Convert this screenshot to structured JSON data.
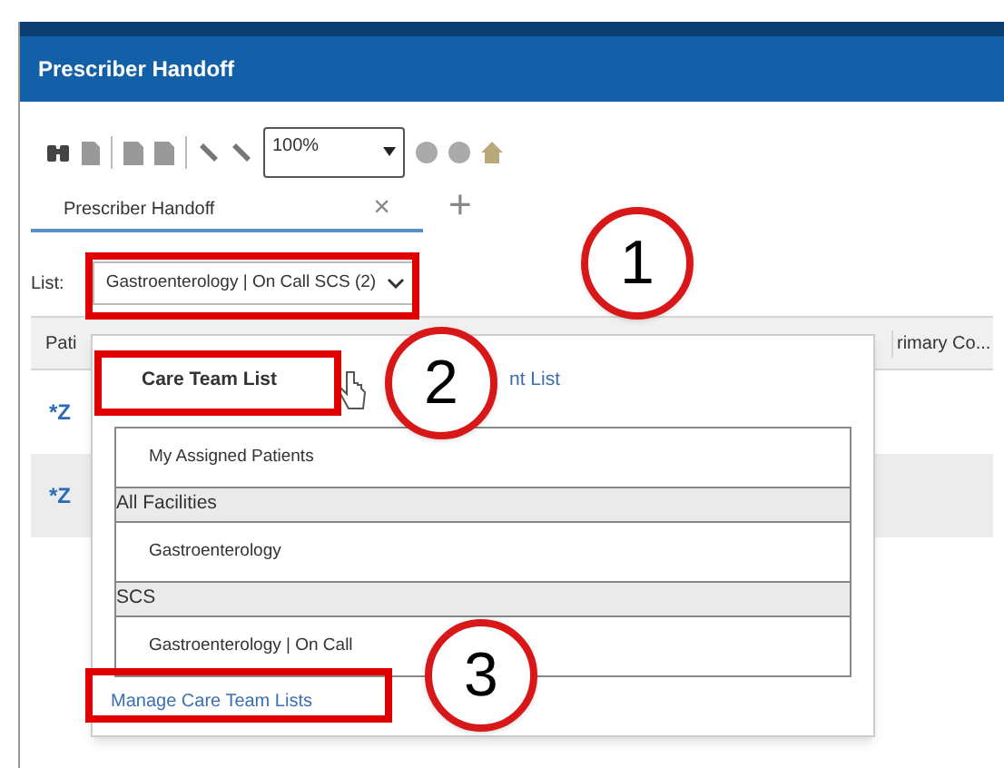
{
  "window": {
    "title": "Prescriber Handoff"
  },
  "toolbar": {
    "zoom": "100%"
  },
  "tabs": [
    {
      "label": "Prescriber Handoff",
      "selected": true,
      "close": "×"
    }
  ],
  "new_tab": "+",
  "list_selector": {
    "label": "List:",
    "value": "Gastroenterology | On Call SCS (2)"
  },
  "table": {
    "columns": [
      "Pati",
      "rimary Co..."
    ],
    "rows": [
      {
        "cells": [
          "*Z"
        ],
        "selected": false
      },
      {
        "cells": [
          "*Z"
        ],
        "selected": true
      }
    ]
  },
  "popup": {
    "tabs": [
      {
        "label": "Care Team List",
        "selected": true
      },
      {
        "label": "nt List",
        "selected": false
      }
    ],
    "items": [
      {
        "kind": "item",
        "label": "My Assigned Patients"
      },
      {
        "kind": "header",
        "label": "All Facilities"
      },
      {
        "kind": "item",
        "label": "Gastroenterology"
      },
      {
        "kind": "header",
        "label": "SCS"
      },
      {
        "kind": "item",
        "label": "Gastroenterology | On Call"
      }
    ],
    "link": "Manage Care Team Lists"
  },
  "callouts": [
    "1",
    "2",
    "3"
  ]
}
